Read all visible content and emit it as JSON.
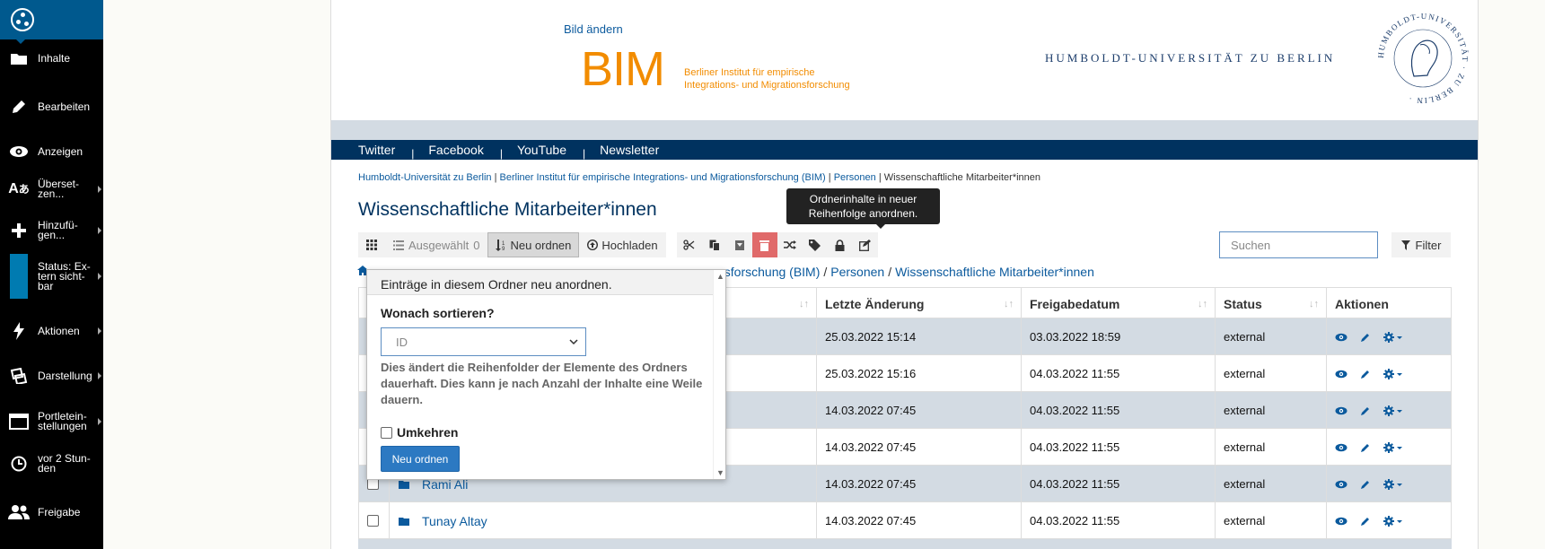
{
  "toolbar": {
    "items": [
      {
        "label": "Inhalte",
        "icon": "folder-icon",
        "submenu": false
      },
      {
        "label": "Bearbeiten",
        "icon": "pencil-icon",
        "submenu": false
      },
      {
        "label": "Anzeigen",
        "icon": "eye-icon",
        "submenu": false
      },
      {
        "label": "Überset-zen...",
        "icon": "translate-icon",
        "submenu": true
      },
      {
        "label": "Hinzufü-gen...",
        "icon": "plus-icon",
        "submenu": true
      },
      {
        "label": "Status: Ex-tern sicht-bar",
        "icon": "status-icon",
        "submenu": true
      },
      {
        "label": "Aktionen",
        "icon": "bolt-icon",
        "submenu": true
      },
      {
        "label": "Darstellung",
        "icon": "display-icon",
        "submenu": true
      },
      {
        "label": "Portletein-stellungen",
        "icon": "portlet-icon",
        "submenu": true
      },
      {
        "label": "vor 2 Stun-den",
        "icon": "clock-icon",
        "submenu": false
      },
      {
        "label": "Freigabe",
        "icon": "users-icon",
        "submenu": false
      }
    ]
  },
  "header": {
    "bild_link": "Bild ändern",
    "bim_logo": "BIM",
    "bim_sub_line1": "Berliner Institut für empirische",
    "bim_sub_line2": "Integrations- und Migrationsforschung",
    "hu_name": "HUMBOLDT-UNIVERSITÄT ZU BERLIN",
    "hu_seal_text": "HUMBOLDT-UNIVERSITÄT · ZU BERLIN ·"
  },
  "nav": {
    "links": [
      "Twitter",
      "Facebook",
      "YouTube",
      "Newsletter"
    ]
  },
  "breadcrumbs": {
    "items": [
      "Humboldt-Universität zu Berlin",
      "Berliner Institut für empirische Integrations- und Migrationsforschung (BIM)",
      "Personen"
    ],
    "current": "Wissenschaftliche Mitarbeiter*innen"
  },
  "page_title": "Wissenschaftliche Mitarbeiter*innen",
  "action_bar": {
    "selected_label": "Ausgewählt",
    "selected_count": "0",
    "reorder_label": "Neu ordnen",
    "upload_label": "Hochladen",
    "search_placeholder": "Suchen",
    "filter_label": "Filter"
  },
  "tooltip": {
    "line1": "Ordnerinhalte in neuer",
    "line2": "Reihenfolge anordnen."
  },
  "path_bar": {
    "partial": "nsforschung (BIM)",
    "personen": "Personen",
    "current": "Wissenschaftliche Mitarbeiter*innen",
    "sep": "/"
  },
  "table": {
    "columns": [
      "Letzte Änderung",
      "Freigabedatum",
      "Status",
      "Aktionen"
    ],
    "rows": [
      {
        "title": "",
        "modified": "25.03.2022 15:14",
        "published": "03.03.2022 18:59",
        "status": "external"
      },
      {
        "title": "",
        "modified": "25.03.2022 15:16",
        "published": "04.03.2022 11:55",
        "status": "external"
      },
      {
        "title": "",
        "modified": "14.03.2022 07:45",
        "published": "04.03.2022 11:55",
        "status": "external"
      },
      {
        "title": "",
        "modified": "14.03.2022 07:45",
        "published": "04.03.2022 11:55",
        "status": "external"
      },
      {
        "title": "Rami Ali",
        "modified": "14.03.2022 07:45",
        "published": "04.03.2022 11:55",
        "status": "external"
      },
      {
        "title": "Tunay Altay",
        "modified": "14.03.2022 07:45",
        "published": "04.03.2022 11:55",
        "status": "external"
      }
    ]
  },
  "popover": {
    "heading": "Einträge in diesem Ordner neu anordnen.",
    "question": "Wonach sortieren?",
    "select_value": "ID",
    "help_text": "Dies ändert die Reihenfolder der Elemente des Ordners dauerhaft. Dies kann je nach Anzahl der Inhalte eine Weile dauern.",
    "reverse_label": "Umkehren",
    "submit_label": "Neu ordnen"
  },
  "colors": {
    "toolbar_bg": "#000000",
    "toolbar_accent": "#00598e",
    "nav_bg": "#00325f",
    "link": "#0b5a9d",
    "bim_orange": "#f28c00",
    "row_alt": "#d3dbe3",
    "danger": "#e06a6a",
    "primary_button": "#2c79c2"
  }
}
